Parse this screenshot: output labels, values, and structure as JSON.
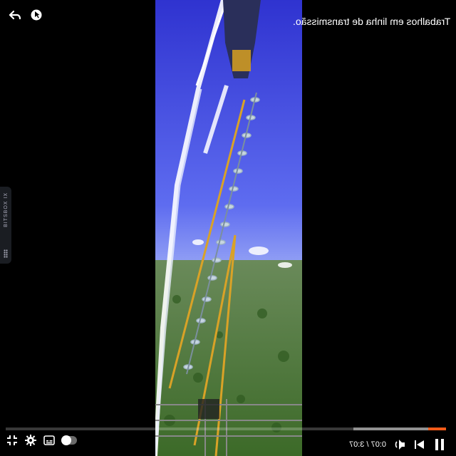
{
  "video": {
    "title": "Trabalhos em linha de transmissão.",
    "time_display": "0:07 / 3:07",
    "played_fraction": 0.04,
    "buffered_fraction": 0.21
  },
  "side_tab": {
    "label": "BITSBOX IX"
  },
  "icons": {
    "back": "undo-arrow-icon",
    "pointer": "cursor-circle-icon",
    "fullscreen": "fullscreen-exit-icon",
    "settings": "gear-icon",
    "subtitles": "subtitles-icon",
    "autoplay": "autoplay-toggle",
    "volume": "volume-icon",
    "next": "skip-next-icon",
    "pause": "pause-icon"
  },
  "colors": {
    "progress_played": "#f35b19",
    "sky": "#3d44d8",
    "vegetation": "#3f6b2c",
    "background": "#000000"
  }
}
